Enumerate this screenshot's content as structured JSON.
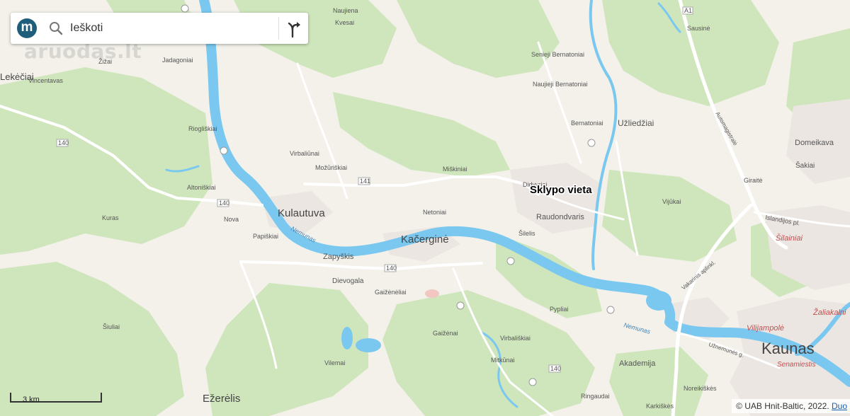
{
  "search": {
    "logo_letter": "m",
    "placeholder": "Ieškoti"
  },
  "watermark": "aruodas.lt",
  "marker_label": "Sklypo vieta",
  "scale_label": "3 km",
  "copyright": {
    "text": "© UAB Hnit-Baltic, 2022.",
    "link": "Duo"
  },
  "map": {
    "colors": {
      "land": "#f3f1ea",
      "forest": "#cfe6bc",
      "water": "#7ac8ef",
      "road": "#ffffff",
      "urban": "#ece6e3"
    },
    "places": {
      "kaunas": "Kaunas",
      "kacergine": "Kačerginė",
      "kulautuva": "Kulautuva",
      "ezerelis": "Ežerėlis",
      "lekeciai": "Lekėčiai",
      "zapyskis": "Zapyškis",
      "raudondvaris": "Raudondvaris",
      "uzliedziai": "Užliedžiai",
      "domeikava": "Domeikava",
      "akademija": "Akademija",
      "vilijampole": "Vilijampolė",
      "zaliakalnis": "Žaliakalni",
      "senamiestis": "Senamiestis",
      "siliainiai": "Šilainiai",
      "kvesai": "Kvesai",
      "naujiena": "Naujiena",
      "zizai": "Žižai",
      "jadagoniai": "Jadagoniai",
      "vincentavas": "Vincentavas",
      "riogliskiai": "Riogliškiai",
      "virbaliunai": "Virbaliūnai",
      "mozuriskiai": "Možūriškiai",
      "miskiniai": "Miškiniai",
      "altoniskiai": "Altoniškiai",
      "netoniai": "Netoniai",
      "kuras": "Kuras",
      "nova": "Nova",
      "papiskiai": "Papiškiai",
      "dievogala": "Dievogala",
      "gaizeneliai": "Gaižėnėliai",
      "gaizenai": "Gaižėnai",
      "virbaliskiai": "Virbališkiai",
      "vilemai": "Vilemai",
      "mitkunai": "Mitkūnai",
      "ringaudai": "Ringaudai",
      "siulai": "Šiuliai",
      "pypliai": "Pypliai",
      "silelis": "Šilelis",
      "didvyriai": "Didvyriai",
      "bernatoniai": "Bernatoniai",
      "senieji_bernatoniai": "Senieji Bernatoniai",
      "naujieji_bernatoniai": "Naujieji Bernatoniai",
      "sausine": "Sausinė",
      "sakiai": "Šakiai",
      "giraite": "Giraitė",
      "vijukai": "Vijūkai",
      "noreikiskes": "Noreikiškės",
      "karkiskes": "Karkiškės",
      "nemunas": "Nemunas",
      "automagistrale": "Automagistralė",
      "islandijos_pl": "Islandijos pl.",
      "vakarinis": "Vakarinis aplinkl.",
      "uznemunes": "Užnemunės g."
    },
    "roads": {
      "r140": "140",
      "r141": "141",
      "a1": "A1"
    }
  }
}
